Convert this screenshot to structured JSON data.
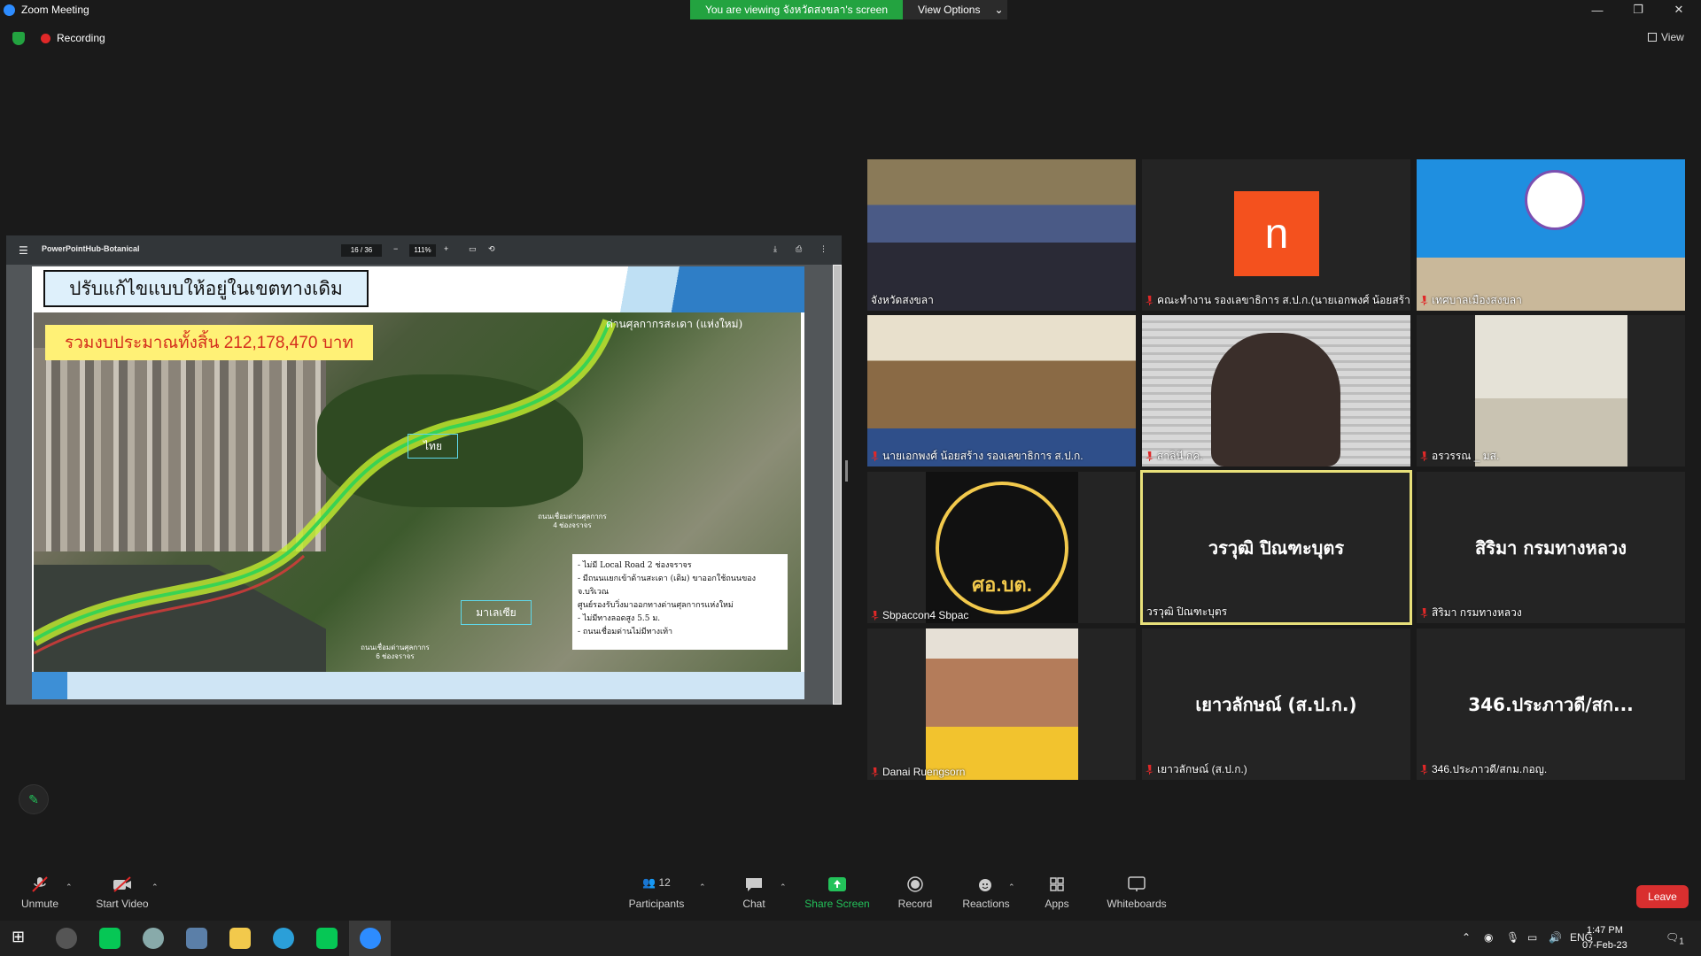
{
  "window": {
    "title": "Zoom Meeting",
    "viewing_banner": "You are viewing จังหวัดสงขลา's screen",
    "view_options": "View Options",
    "view_label": "View"
  },
  "recording": {
    "label": "Recording"
  },
  "pdf": {
    "doc_title": "PowerPointHub-Botanical",
    "page": "16",
    "pages": "36",
    "zoom": "111%"
  },
  "slide": {
    "title": "ปรับแก้ไขแบบให้อยู่ในเขตทางเดิม",
    "budget": "รวมงบประมาณทั้งสิ้น 212,178,470 บาท",
    "label_checkpoint": "ด่านศุลกากรสะเดา (แห่งใหม่)",
    "label_thai": "ไทย",
    "label_malaysia": "มาเลเซีย",
    "road_4lane": "ถนนเชื่อมด่านศุลกากร\n4 ช่องจราจร",
    "road_6lane": "ถนนเชื่อมด่านศุลกากร\n6 ช่องจราจร",
    "notes": [
      "- ไม่มี Local Road 2 ช่องจราจร",
      "- มีถนนแยกเข้าด้านสะเดา (เดิม) ขาออกใช้ถนนของ จ.บริเวณ",
      "ศูนย์รองรับวิ่งมาออกทางด่านศุลกากรแห่งใหม่",
      "- ไม่มีทางลอดสูง 5.5 ม.",
      "- ถนนเชื่อมด่านไม่มีทางเท้า"
    ]
  },
  "participants": [
    {
      "name": "จังหวัดสงขลา",
      "muted": false,
      "kind": "room"
    },
    {
      "name": "คณะทำงาน รองเลขาธิการ ส.ป.ก.(นายเอกพงศ์ น้อยสร้าง)",
      "muted": true,
      "kind": "avatar",
      "initial": "n",
      "avatar_color": "#f4511e"
    },
    {
      "name": "เทศบาลเมืองสงขลา",
      "muted": true,
      "kind": "office"
    },
    {
      "name": "นายเอกพงศ์ น้อยสร้าง รองเลขาธิการ ส.ป.ก.",
      "muted": true,
      "kind": "person"
    },
    {
      "name": "สาลินี กค.",
      "muted": true,
      "kind": "person"
    },
    {
      "name": "อรวรรณ _ มส.",
      "muted": true,
      "kind": "person"
    },
    {
      "name": "Sbpaccon4 Sbpac",
      "muted": true,
      "kind": "emblem",
      "emblem_text": "ศอ.บต."
    },
    {
      "name": "วรวุฒิ ปิณฑะบุตร",
      "muted": false,
      "kind": "name",
      "big": "วรวุฒิ ปิณฑะบุตร",
      "active": true
    },
    {
      "name": "สิริมา กรมทางหลวง",
      "muted": true,
      "kind": "name",
      "big": "สิริมา กรมทางหลวง"
    },
    {
      "name": "Danai Ruengsorn",
      "muted": true,
      "kind": "person"
    },
    {
      "name": "เยาวลักษณ์ (ส.ป.ก.)",
      "muted": true,
      "kind": "name",
      "big": "เยาวลักษณ์ (ส.ป.ก.)"
    },
    {
      "name": "346.ประภาวดี/สกม.กอญ.",
      "muted": true,
      "kind": "name",
      "big": "346.ประภาวดี/สก..."
    }
  ],
  "toolbar": {
    "unmute": "Unmute",
    "start_video": "Start Video",
    "participants": "Participants",
    "participant_count": "12",
    "chat": "Chat",
    "share_screen": "Share Screen",
    "record": "Record",
    "reactions": "Reactions",
    "apps": "Apps",
    "whiteboards": "Whiteboards",
    "leave": "Leave"
  },
  "taskbar": {
    "lang": "ENG",
    "time": "1:47 PM",
    "date": "07-Feb-23",
    "notif_count": "1"
  },
  "colors": {
    "green": "#23a340",
    "red": "#e02828",
    "active_border": "#e8e07a",
    "zoom_blue": "#2d8cff"
  }
}
